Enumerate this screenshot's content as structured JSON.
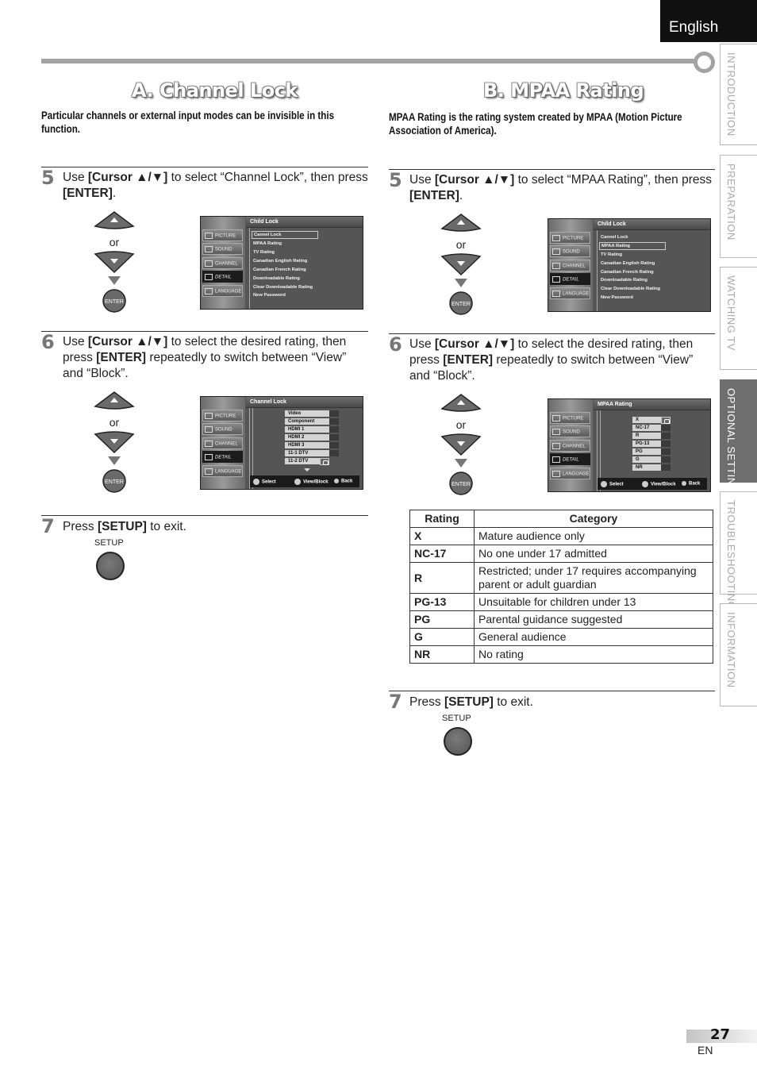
{
  "language_tab": "English",
  "side_tabs": [
    {
      "label": "INTRODUCTION",
      "active": false
    },
    {
      "label": "PREPARATION",
      "active": false
    },
    {
      "label": "WATCHING  TV",
      "active": false
    },
    {
      "label": "OPTIONAL  SETTING",
      "active": true
    },
    {
      "label": "TROUBLESHOOTING",
      "active": false
    },
    {
      "label": "INFORMATION",
      "active": false
    }
  ],
  "section_a": {
    "title": "A.  Channel Lock",
    "description": "Particular channels or external input modes can be invisible in this function.",
    "step5": {
      "num": "5",
      "pre": "Use ",
      "bold1": "[Cursor ▲/▼]",
      "mid": " to select “Channel Lock”, then press ",
      "bold2": "[ENTER]",
      "post": "."
    },
    "step6": {
      "num": "6",
      "pre": "Use ",
      "bold1": "[Cursor ▲/▼]",
      "mid": " to select the desired rating, then press ",
      "bold2": "[ENTER]",
      "post": " repeatedly to switch between “View” and “Block”."
    },
    "step7": {
      "num": "7",
      "pre": "Press ",
      "bold1": "[SETUP]",
      "post": " to exit."
    },
    "setup_label": "SETUP",
    "screen1": {
      "title": "Child Lock",
      "items": [
        "Cannel Lock",
        "MPAA Rating",
        "TV Rating",
        "Canadian English Rating",
        "Canadian French Rating",
        "Downloadable Rating",
        "Clear Downloadable Rating",
        "New Password"
      ],
      "selected_index": 0
    },
    "screen2": {
      "title": "Channel Lock",
      "rows": [
        {
          "label": "Video",
          "locked": false
        },
        {
          "label": "Component",
          "locked": false
        },
        {
          "label": "HDMI 1",
          "locked": false
        },
        {
          "label": "HDMI 2",
          "locked": false
        },
        {
          "label": "HDMI 3",
          "locked": false
        },
        {
          "label": "11-1 DTV",
          "locked": false
        },
        {
          "label": "11-2 DTV",
          "locked": true
        }
      ]
    }
  },
  "section_b": {
    "title": "B. MPAA Rating",
    "description": "MPAA Rating is the rating system created by MPAA (Motion Picture Association of America).",
    "step5": {
      "num": "5",
      "pre": "Use ",
      "bold1": "[Cursor ▲/▼]",
      "mid": " to select “MPAA Rating”, then press ",
      "bold2": "[ENTER]",
      "post": "."
    },
    "step6": {
      "num": "6",
      "pre": "Use ",
      "bold1": "[Cursor ▲/▼]",
      "mid": " to select the desired rating, then press ",
      "bold2": "[ENTER]",
      "post": " repeatedly to switch between “View” and “Block”."
    },
    "step7": {
      "num": "7",
      "pre": "Press ",
      "bold1": "[SETUP]",
      "post": " to exit."
    },
    "setup_label": "SETUP",
    "screen1": {
      "title": "Child Lock",
      "items": [
        "Cannel Lock",
        "MPAA Rating",
        "TV Rating",
        "Canadian English Rating",
        "Canadian French Rating",
        "Downloadable Rating",
        "Clear Downloadable Rating",
        "New Password"
      ],
      "selected_index": 1
    },
    "screen2": {
      "title": "MPAA Rating",
      "rows": [
        {
          "label": "X",
          "locked": true
        },
        {
          "label": "NC-17",
          "locked": false
        },
        {
          "label": "R",
          "locked": false
        },
        {
          "label": "PG-13",
          "locked": false
        },
        {
          "label": "PG",
          "locked": false
        },
        {
          "label": "G",
          "locked": false
        },
        {
          "label": "NR",
          "locked": false
        }
      ]
    },
    "table": {
      "headers": [
        "Rating",
        "Category"
      ],
      "rows": [
        [
          "X",
          "Mature audience only"
        ],
        [
          "NC-17",
          "No one under 17 admitted"
        ],
        [
          "R",
          "Restricted; under 17 requires accompanying parent or adult guardian"
        ],
        [
          "PG-13",
          "Unsuitable for children under 13"
        ],
        [
          "PG",
          "Parental guidance suggested"
        ],
        [
          "G",
          "General audience"
        ],
        [
          "NR",
          "No rating"
        ]
      ]
    }
  },
  "remote": {
    "or_label": "or",
    "enter_label": "ENTER"
  },
  "tv_side_menu": [
    "PICTURE",
    "SOUND",
    "CHANNEL",
    "DETAIL",
    "LANGUAGE"
  ],
  "tv_side_active": "DETAIL",
  "tv_footer": {
    "select": "Select",
    "view_block": "View/Block",
    "back": "Back",
    "back_small": "BACK"
  },
  "footer": {
    "page_number": "27",
    "lang_code": "EN"
  }
}
